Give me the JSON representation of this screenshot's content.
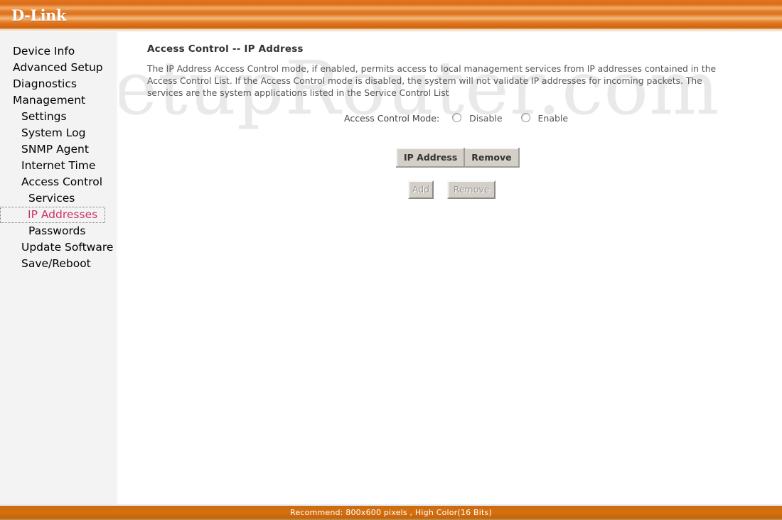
{
  "header": {
    "logo_text": "D-Link",
    "accent_color": "#e2751c"
  },
  "watermark": {
    "text": "SetupRouter.com"
  },
  "sidebar": {
    "items": [
      {
        "label": "Device Info",
        "level": 1,
        "active": false
      },
      {
        "label": "Advanced Setup",
        "level": 1,
        "active": false
      },
      {
        "label": "Diagnostics",
        "level": 1,
        "active": false
      },
      {
        "label": "Management",
        "level": 1,
        "active": false
      },
      {
        "label": "Settings",
        "level": 2,
        "active": false
      },
      {
        "label": "System Log",
        "level": 2,
        "active": false
      },
      {
        "label": "SNMP Agent",
        "level": 2,
        "active": false
      },
      {
        "label": "Internet Time",
        "level": 2,
        "active": false
      },
      {
        "label": "Access Control",
        "level": 2,
        "active": false
      },
      {
        "label": "Services",
        "level": 3,
        "active": false
      },
      {
        "label": "IP Addresses",
        "level": 3,
        "active": true
      },
      {
        "label": "Passwords",
        "level": 3,
        "active": false
      },
      {
        "label": "Update Software",
        "level": 2,
        "active": false
      },
      {
        "label": "Save/Reboot",
        "level": 2,
        "active": false
      }
    ],
    "active_color": "#cc3366"
  },
  "main": {
    "title": "Access Control -- IP Address",
    "description": "The IP Address Access Control mode, if enabled, permits access to local management services from IP addresses contained in the Access Control List. If the Access Control mode is disabled, the system will not validate IP addresses for incoming packets. The services are the system applications listed in the Service Control List",
    "mode": {
      "label": "Access Control Mode:",
      "options": [
        {
          "label": "Disable",
          "selected": false
        },
        {
          "label": "Enable",
          "selected": false
        }
      ]
    },
    "table": {
      "columns": [
        "IP Address",
        "Remove"
      ],
      "rows": []
    },
    "buttons": {
      "add": "Add",
      "remove": "Remove"
    }
  },
  "footer": {
    "text": "Recommend: 800x600 pixels , High Color(16 Bits)"
  }
}
